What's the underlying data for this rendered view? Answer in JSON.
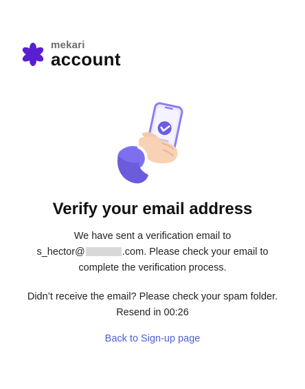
{
  "brand": {
    "small": "mekari",
    "big": "account",
    "accent_color": "#5a1fd1",
    "icon": "mekari-star-logo"
  },
  "illustration": {
    "icon": "hand-holding-phone-checkmark-icon"
  },
  "title": "Verify your email address",
  "message": {
    "line1": "We have sent a verification email to",
    "email_user": "s_hector@",
    "email_domain": ".com. Please check your email to",
    "line3": "complete the verification process."
  },
  "spam_notice": {
    "line1": "Didn’t receive the email? Please check your spam folder.",
    "resend": "Resend in 00:26"
  },
  "back_link": {
    "label": "Back to Sign-up page",
    "color": "#4b61d1"
  }
}
